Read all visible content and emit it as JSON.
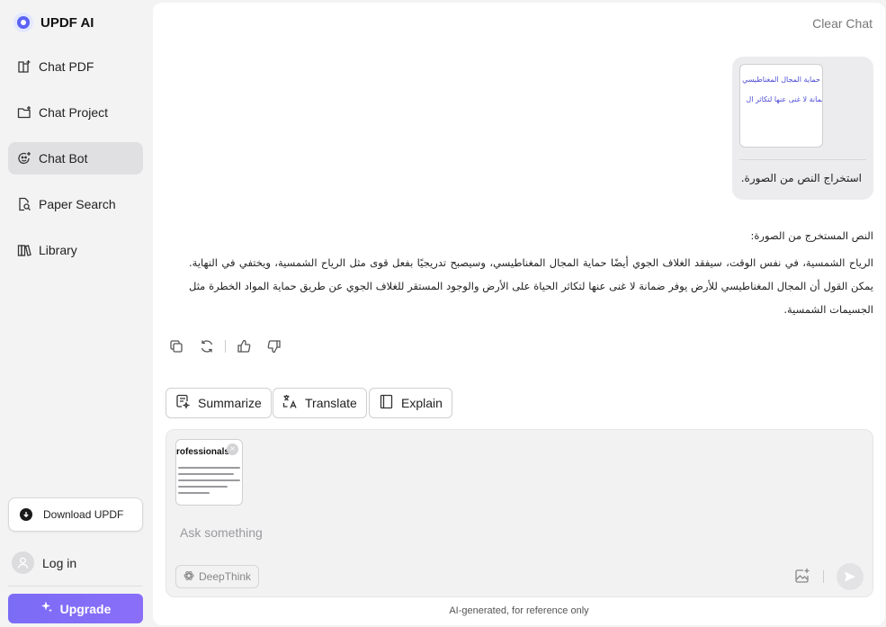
{
  "app": {
    "title": "UPDF AI"
  },
  "sidebar": {
    "items": [
      {
        "label": "Chat PDF",
        "icon": "book-plus-icon"
      },
      {
        "label": "Chat Project",
        "icon": "folder-plus-icon"
      },
      {
        "label": "Chat Bot",
        "icon": "bot-face-icon",
        "active": true
      },
      {
        "label": "Paper Search",
        "icon": "document-search-icon"
      },
      {
        "label": "Library",
        "icon": "library-icon"
      }
    ],
    "download_label": "Download UPDF",
    "login_label": "Log in",
    "upgrade_label": "Upgrade"
  },
  "main": {
    "clear_chat_label": "Clear Chat",
    "user_message": {
      "thumbnail_line1": "حماية المجال المغناطيسي",
      "thumbnail_line2": "ضمانة لا غنى عنها لتكاثر ال",
      "text": "استخراج النص من الصورة."
    },
    "answer": {
      "heading": "النص المستخرج من الصورة:",
      "body": "الرياح الشمسية، في نفس الوقت، سيفقد الغلاف الجوي أيضًا حماية المجال المغناطيسي، وسيصبح تدريجيًا بفعل قوى مثل الرياح الشمسية، ويختفي في النهاية. يمكن القول أن المجال المغناطيسي للأرض يوفر ضمانة لا غنى عنها لتكاثر الحياة على الأرض والوجود المستقر للغلاف الجوي عن طريق حماية المواد الخطرة مثل الجسيمات الشمسية."
    },
    "quick_actions": [
      {
        "label": "Summarize",
        "icon": "summarize-icon"
      },
      {
        "label": "Translate",
        "icon": "translate-icon"
      },
      {
        "label": "Explain",
        "icon": "book-icon"
      }
    ],
    "composer": {
      "attachment_title": "rofessionals",
      "placeholder": "Ask something",
      "deepthink_label": "DeepThink"
    },
    "footer_note": "AI-generated, for reference only"
  },
  "colors": {
    "accent": "#7b6cf6",
    "brand_blue": "#5b63f5",
    "thumb_text": "#4b4bd8"
  }
}
